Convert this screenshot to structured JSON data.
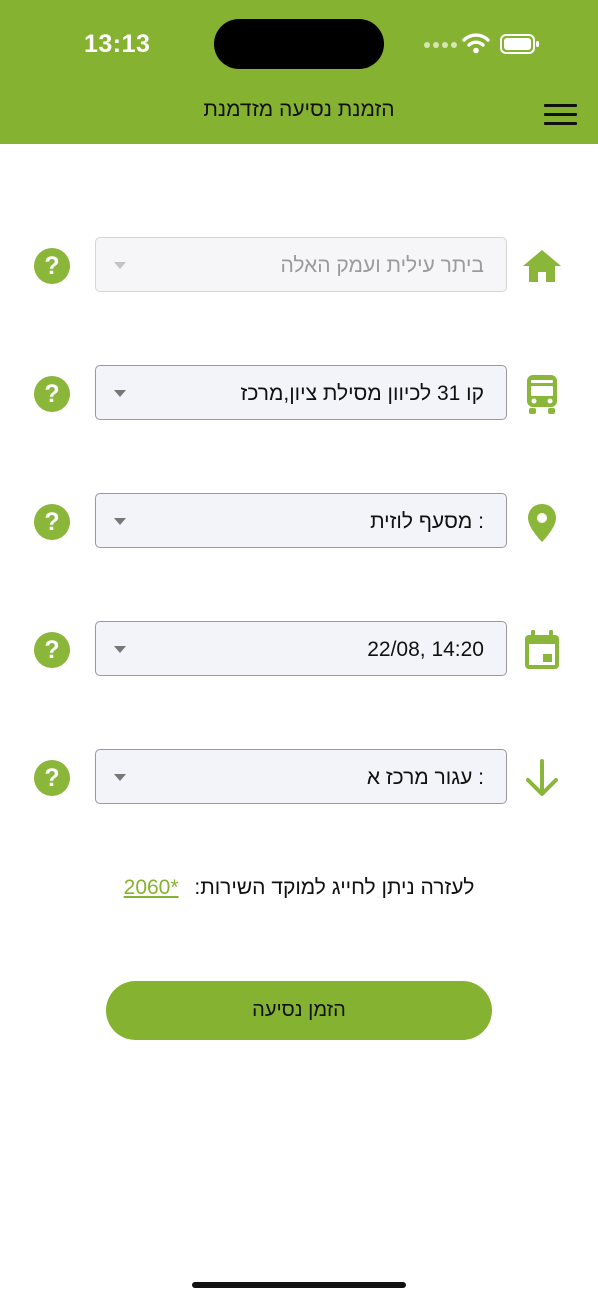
{
  "status_bar": {
    "time": "13:13"
  },
  "header": {
    "title": "הזמנת נסיעה מזדמנת"
  },
  "colors": {
    "brand": "#86b232",
    "help_icon": "#8ab63a"
  },
  "form": {
    "fields": [
      {
        "icon": "home-icon",
        "value": "ביתר עילית ועמק האלה",
        "disabled": true
      },
      {
        "icon": "bus-icon",
        "value": "קו 31 לכיוון מסילת ציון,מרכז",
        "disabled": false
      },
      {
        "icon": "location-pin-icon",
        "value": ": מסעף לוזית",
        "disabled": false
      },
      {
        "icon": "calendar-icon",
        "value": "22/08, 14:20",
        "disabled": false
      },
      {
        "icon": "arrow-down-icon",
        "value": ": עגור מרכז א",
        "disabled": false
      }
    ],
    "help_text": "לעזרה ניתן לחייג למוקד השירות:",
    "help_phone": "2060*",
    "submit_label": "הזמן נסיעה",
    "help_icon_glyph": "?"
  }
}
